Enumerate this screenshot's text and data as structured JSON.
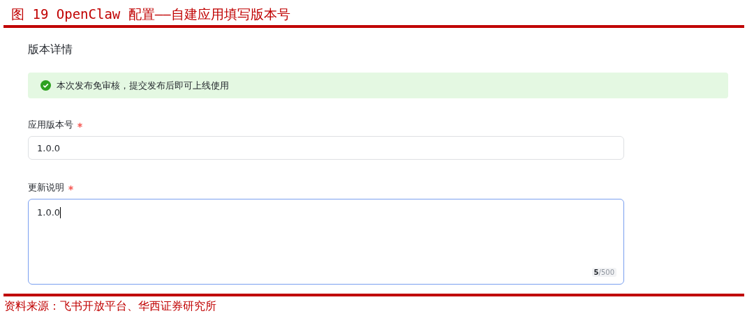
{
  "caption": "图 19 OpenClaw 配置——自建应用填写版本号",
  "panel": {
    "title": "版本详情",
    "notice": {
      "kind": "success",
      "text": "本次发布免审核，提交发布后即可上线使用"
    },
    "fields": [
      {
        "kind": "input",
        "label": "应用版本号",
        "required": true,
        "value": "1.0.0",
        "focused": false
      },
      {
        "kind": "textarea",
        "label": "更新说明",
        "required": true,
        "value": "1.0.0",
        "focused": true,
        "counter": "**5**/500"
      }
    ]
  },
  "source": "资料来源：飞书开放平台、华西证券研究所"
}
